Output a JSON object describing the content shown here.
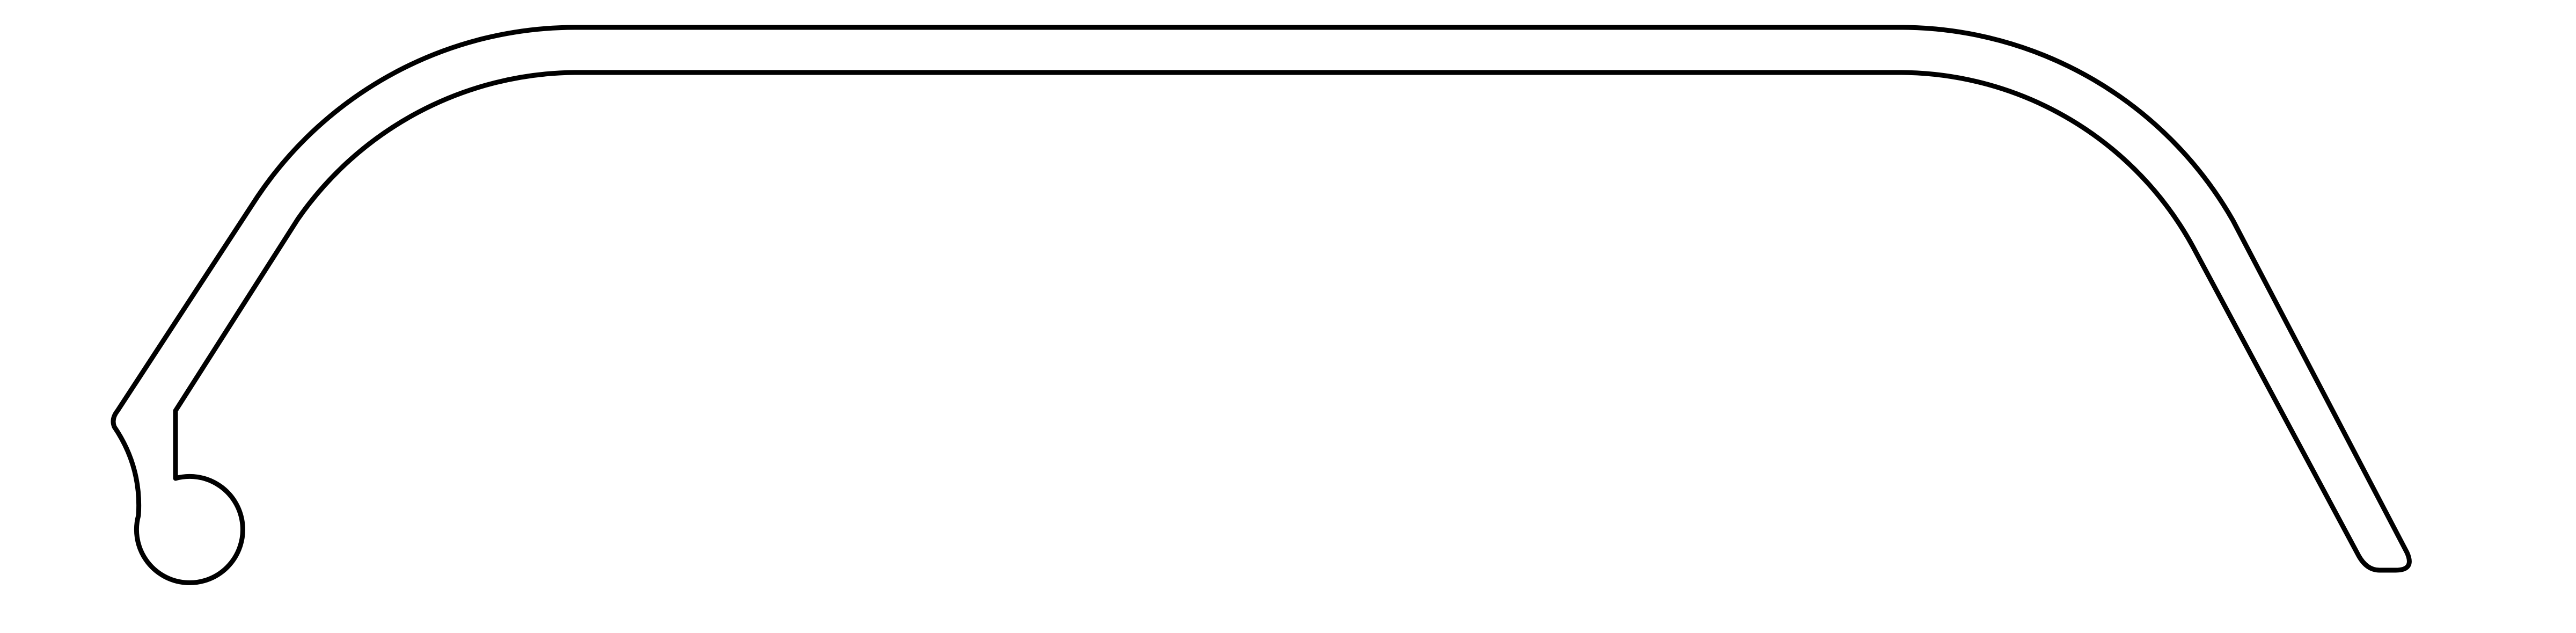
{
  "drawing": {
    "subject": "extruded-profile-cross-section",
    "background_color": "#ffffff",
    "stroke_color": "#000000",
    "fill_color": "#ffffff"
  }
}
